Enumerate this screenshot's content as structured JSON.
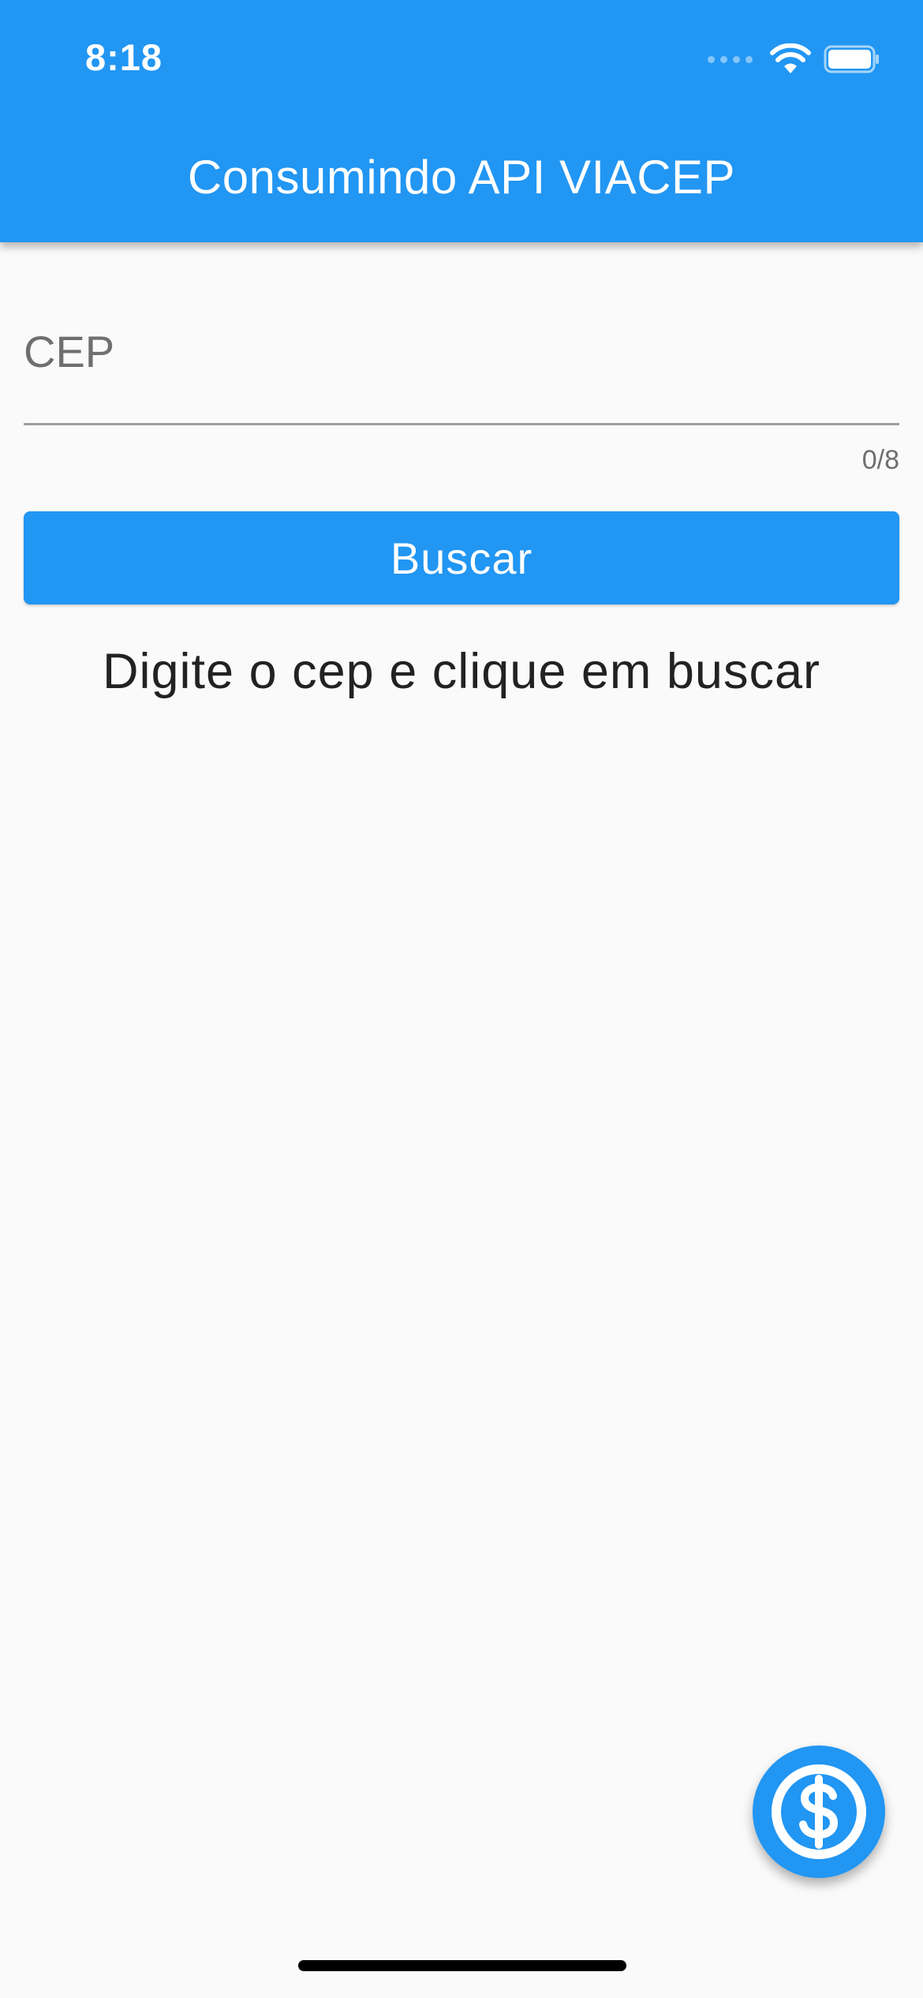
{
  "status_bar": {
    "time": "8:18",
    "icons": [
      "cellular-signal-icon",
      "wifi-icon",
      "battery-icon"
    ]
  },
  "app_bar": {
    "title": "Consumindo API VIACEP",
    "color": "#2196f3"
  },
  "cep_field": {
    "placeholder": "CEP",
    "value": "",
    "counter": "0/8"
  },
  "search_button": {
    "label": "Buscar"
  },
  "result": {
    "message": "Digite o cep e clique em buscar"
  },
  "fab": {
    "icon": "dollar-circle-icon"
  }
}
